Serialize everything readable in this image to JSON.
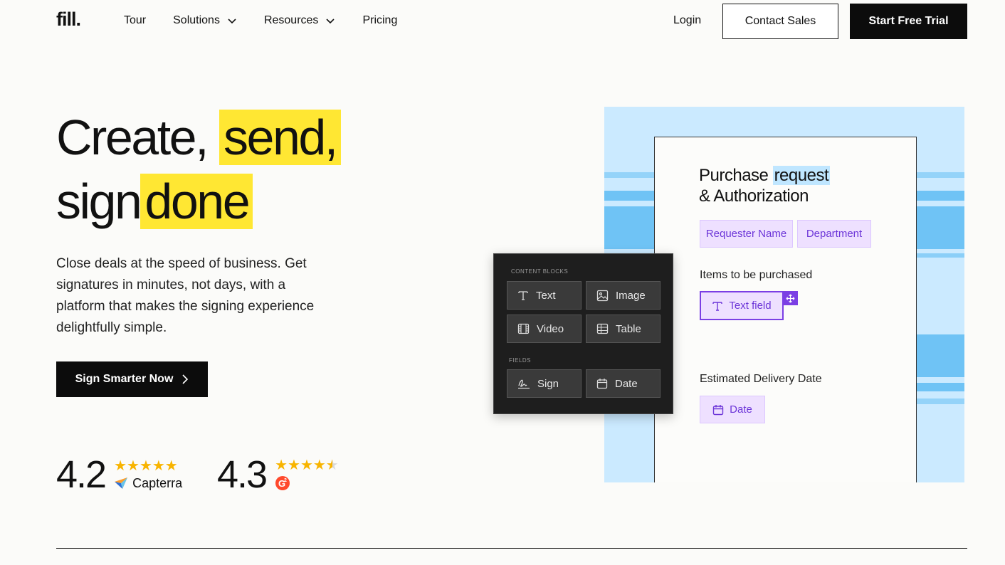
{
  "nav": {
    "logo": "fill.",
    "links": [
      {
        "label": "Tour",
        "dropdown": false
      },
      {
        "label": "Solutions",
        "dropdown": true
      },
      {
        "label": "Resources",
        "dropdown": true
      },
      {
        "label": "Pricing",
        "dropdown": false
      }
    ],
    "login": "Login",
    "contact_sales": "Contact Sales",
    "start_trial": "Start Free Trial"
  },
  "hero": {
    "title_1": "Create,",
    "title_2": "send,",
    "title_3": "sign",
    "title_4": "done",
    "description": "Close deals at the speed of business. Get signatures in minutes, not days, with a platform that makes the signing experience delightfully simple.",
    "cta": "Sign Smarter Now",
    "highlight_color": "#ffe733"
  },
  "ratings": [
    {
      "score": "4.2",
      "stars": "★★★★★",
      "source": "Capterra",
      "source_icon": "capterra-logo-icon"
    },
    {
      "score": "4.3",
      "stars": "★★★★",
      "source_icon": "g2-logo-icon"
    }
  ],
  "document": {
    "title_1": "Purchase",
    "title_2": "request",
    "title_3": "& Authorization",
    "chip_requester": "Requester Name",
    "chip_department": "Department",
    "label_items": "Items to be purchased",
    "text_field": "Text field",
    "label_delivery": "Estimated Delivery Date",
    "date_chip": "Date",
    "accent": "#7b3fe4"
  },
  "panel": {
    "content_blocks_label": "CONTENT BLOCKS",
    "fields_label": "FIELDS",
    "blocks": {
      "text": "Text",
      "image": "Image",
      "video": "Video",
      "table": "Table"
    },
    "fields": {
      "sign": "Sign",
      "date": "Date"
    }
  }
}
